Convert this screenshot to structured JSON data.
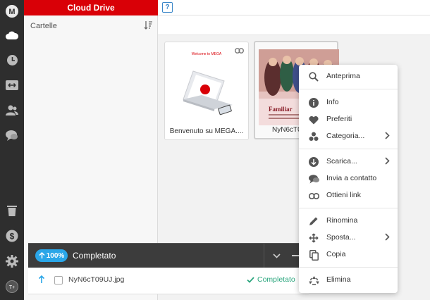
{
  "header": {
    "title": "Cloud Drive",
    "help": "?"
  },
  "sidebar": {
    "logo": "M",
    "avatar": "T+",
    "icons": [
      "cloud-icon",
      "clock-icon",
      "transfers-icon",
      "contacts-icon",
      "chat-icon",
      "trash-icon",
      "dollar-icon",
      "gear-icon"
    ]
  },
  "folders": {
    "title": "Cartelle"
  },
  "files": [
    {
      "name": "Benvenuto su MEGA....",
      "thumb_caption": "Welcome to MEGA"
    },
    {
      "name": "NyN6cT0",
      "thumb_caption": "Familiar"
    }
  ],
  "context_menu": {
    "items": [
      {
        "label": "Anteprima",
        "icon": "search-icon"
      },
      {
        "label": "Info",
        "icon": "info-icon"
      },
      {
        "label": "Preferiti",
        "icon": "heart-icon"
      },
      {
        "label": "Categoria...",
        "icon": "category-icon",
        "submenu": true
      },
      {
        "label": "Scarica...",
        "icon": "download-icon",
        "submenu": true
      },
      {
        "label": "Invia a contatto",
        "icon": "chat-bubble-icon"
      },
      {
        "label": "Ottieni link",
        "icon": "link-icon"
      },
      {
        "label": "Rinomina",
        "icon": "pencil-icon"
      },
      {
        "label": "Sposta...",
        "icon": "move-icon",
        "submenu": true
      },
      {
        "label": "Copia",
        "icon": "copy-icon"
      },
      {
        "label": "Elimina",
        "icon": "recycle-icon"
      }
    ]
  },
  "transfer": {
    "percent": "100%",
    "title": "Completato",
    "file": "NyN6cT09UJ.jpg",
    "status": "Completato"
  },
  "colors": {
    "brand": "#d90007",
    "accent": "#2aa6e8",
    "success": "#2ba67e"
  }
}
